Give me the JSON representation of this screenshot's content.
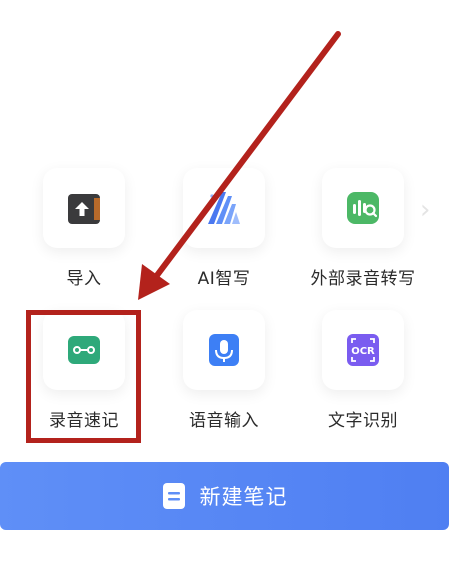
{
  "tools": {
    "import_label": "导入",
    "ai_write_label": "AI智写",
    "external_transcribe_label": "外部录音转写",
    "quick_record_label": "录音速记",
    "voice_input_label": "语音输入",
    "ocr_label": "文字识别"
  },
  "ocr_icon_text": "OCR",
  "new_note": {
    "label": "新建笔记"
  },
  "colors": {
    "highlight_red": "#b3221c",
    "button_blue": "#5f8ff7",
    "import_icon": "#3a3a3c",
    "ai_icon": "#4a78f0",
    "transcribe_icon": "#4cb866",
    "record_icon": "#2ea97a",
    "voice_icon": "#3d7ff5",
    "ocr_icon": "#7a5cf0"
  },
  "icons": {
    "import": "import-icon",
    "ai_write": "ai-write-icon",
    "external_transcribe": "audio-transcribe-icon",
    "quick_record": "recording-icon",
    "voice_input": "microphone-icon",
    "ocr": "ocr-icon",
    "new_note": "note-icon",
    "annotation": "red-arrow-annotation"
  }
}
